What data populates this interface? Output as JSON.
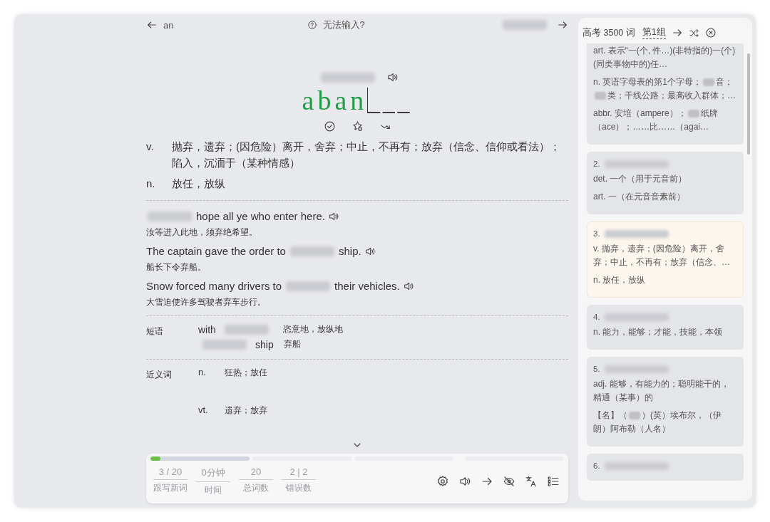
{
  "top_bar": {
    "prev_word": "an",
    "help": "无法输入?"
  },
  "word": {
    "typed": "aban",
    "pending": "___"
  },
  "definitions": [
    {
      "pos": "v.",
      "text": "抛弃，遗弃；(因危险）离开，舍弃；中止，不再有；放弃（信念、信仰或看法）；陷入，沉湎于（某种情感）"
    },
    {
      "pos": "n.",
      "text": "放任，放纵"
    }
  ],
  "examples": [
    {
      "parts": [
        {
          "kind": "blur"
        },
        {
          "kind": "text",
          "text": "hope all ye who enter here."
        }
      ],
      "translation": "汝等进入此地，须弃绝希望。"
    },
    {
      "parts": [
        {
          "kind": "text",
          "text": "The captain gave the order to"
        },
        {
          "kind": "blur"
        },
        {
          "kind": "text",
          "text": "ship."
        }
      ],
      "translation": "船长下令弃船。"
    },
    {
      "parts": [
        {
          "kind": "text",
          "text": "Snow forced many drivers to"
        },
        {
          "kind": "blur"
        },
        {
          "kind": "text",
          "text": "their vehicles."
        }
      ],
      "translation": "大雪迫使许多驾驶者弃车步行。"
    }
  ],
  "phrases": {
    "label": "短语",
    "items": [
      {
        "parts": [
          {
            "kind": "text",
            "text": "with"
          },
          {
            "kind": "blur"
          }
        ],
        "meaning": "恣意地，放纵地"
      },
      {
        "parts": [
          {
            "kind": "blur"
          },
          {
            "kind": "text",
            "text": "ship"
          }
        ],
        "meaning": "弃船"
      }
    ]
  },
  "synonyms": {
    "label": "近义词",
    "items": [
      {
        "pos": "n.",
        "meaning": "狂热；放任"
      },
      {
        "pos": "vt.",
        "meaning": "遗弃；放弃"
      }
    ]
  },
  "progress": [
    {
      "level": 0.1,
      "current": true
    },
    {
      "current": false
    },
    {
      "current": false
    },
    {
      "current": false
    }
  ],
  "stats": [
    {
      "value": "3 / 20",
      "label": "跟写新词"
    },
    {
      "value": "0分钟",
      "label": "时间"
    },
    {
      "value": "20",
      "label": "总词数"
    },
    {
      "value": "2 | 2",
      "label": "错误数"
    }
  ],
  "sidebar": {
    "title": "高考 3500 词",
    "group": "第1组",
    "cards": [
      {
        "selected": false,
        "defs": [
          [
            {
              "kind": "text",
              "text": "art. 表示“一(个, 件…)(非特指的)一(个)(同类事物中的)任…"
            }
          ],
          [
            {
              "kind": "text",
              "text": "n. 英语字母表的第1个字母；"
            },
            {
              "kind": "blur"
            },
            {
              "kind": "text",
              "text": "音；"
            },
            {
              "kind": "blur"
            },
            {
              "kind": "text",
              "text": "类；干线公路；最高收入群体；…"
            }
          ],
          [
            {
              "kind": "text",
              "text": "abbr. 安培（ampere）；"
            },
            {
              "kind": "blur"
            },
            {
              "kind": "text",
              "text": "纸牌（ace）；……比……（agai…"
            }
          ]
        ]
      },
      {
        "number": "2.",
        "selected": false,
        "defs": [
          [
            {
              "kind": "text",
              "text": "det. 一个（用于元音前）"
            }
          ],
          [
            {
              "kind": "text",
              "text": "art. 一（在元音音素前）"
            }
          ]
        ]
      },
      {
        "number": "3.",
        "selected": true,
        "defs": [
          [
            {
              "kind": "text",
              "text": "v. 抛弃，遗弃；(因危险）离开，舍弃；中止，不再有；放弃（信念、…"
            }
          ],
          [
            {
              "kind": "text",
              "text": "n. 放任，放纵"
            }
          ]
        ]
      },
      {
        "number": "4.",
        "selected": false,
        "defs": [
          [
            {
              "kind": "text",
              "text": "n. 能力，能够；才能，技能，本领"
            }
          ]
        ]
      },
      {
        "number": "5.",
        "selected": false,
        "defs": [
          [
            {
              "kind": "text",
              "text": "adj. 能够，有能力的；聪明能干的，精通（某事）的"
            }
          ],
          [
            {
              "kind": "text",
              "text": "【名】（"
            },
            {
              "kind": "blur"
            },
            {
              "kind": "text",
              "text": "）(英）埃布尔，（伊朗）阿布勒（人名）"
            }
          ]
        ]
      },
      {
        "number": "6.",
        "selected": false
      }
    ]
  }
}
